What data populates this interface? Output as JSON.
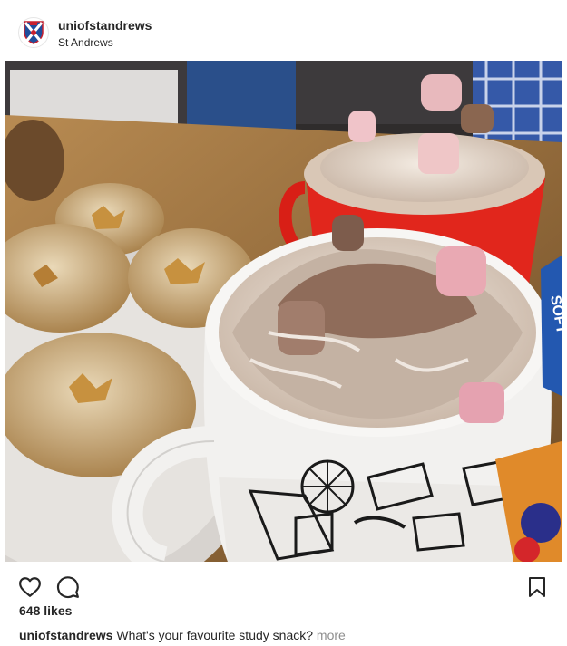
{
  "header": {
    "username": "uniofstandrews",
    "location": "St Andrews"
  },
  "photo": {
    "subject": "hot chocolate with whipped cream and marshmallows beside mince pies",
    "mug_text": "SOFT"
  },
  "actions": {
    "like_icon": "heart-icon",
    "comment_icon": "comment-icon",
    "save_icon": "bookmark-icon"
  },
  "likes": "648 likes",
  "caption": {
    "username": "uniofstandrews",
    "text": "What's your favourite study snack?",
    "more": "more"
  },
  "colors": {
    "text": "#262626",
    "muted": "#8e8e8e",
    "border": "#dbdbdb",
    "crest_blue": "#1f4e9c",
    "crest_red": "#c8202f",
    "mug_red": "#e1261c"
  }
}
